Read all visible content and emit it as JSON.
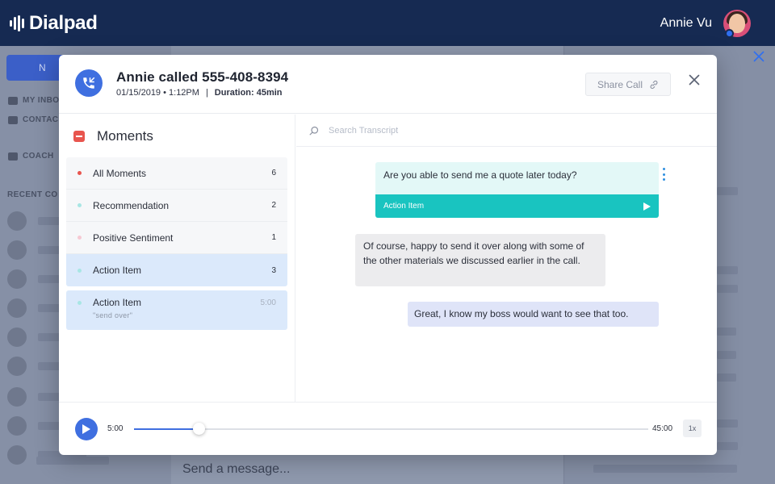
{
  "app": {
    "brand": "Dialpad",
    "user_name": "Annie Vu"
  },
  "background": {
    "sidebar": {
      "call_button_label": "N",
      "nav": [
        "MY INBO",
        "CONTAC",
        "COACH"
      ],
      "recent_label": "RECENT CO"
    },
    "message_placeholder": "Send a message..."
  },
  "modal": {
    "title": "Annie called 555-408-8394",
    "date": "01/15/2019 • 1:12PM",
    "separator": "|",
    "duration": "Duration: 45min",
    "share_label": "Share Call",
    "moments": {
      "title": "Moments",
      "items": [
        {
          "label": "All Moments",
          "count": "6",
          "dot_color": "#e8554e"
        },
        {
          "label": "Recommendation",
          "count": "2",
          "dot_color": "#a8e6e4"
        },
        {
          "label": "Positive Sentiment",
          "count": "1",
          "dot_color": "#f6c9d3"
        },
        {
          "label": "Action Item",
          "count": "3",
          "dot_color": "#a8e6e4"
        }
      ],
      "detail": {
        "label": "Action Item",
        "time": "5:00",
        "quote": "\"send over\"",
        "dot_color": "#a8e6e4"
      }
    },
    "transcript": {
      "search_placeholder": "Search Transcript",
      "messages": [
        {
          "text": "Are you able to send me a quote later today?",
          "tag": "Action Item"
        },
        {
          "text": "Of course, happy to send it over along with some of the other materials we discussed earlier in the call."
        },
        {
          "text": "Great, I know my boss would want to see that too."
        }
      ]
    },
    "player": {
      "current_time": "5:00",
      "total_time": "45:00",
      "progress": 0.125,
      "speed": "1x"
    }
  },
  "colors": {
    "topbar": "#162a52",
    "accent": "#3f6fe0",
    "teal": "#19c4c0",
    "moment_red": "#e8554e"
  }
}
